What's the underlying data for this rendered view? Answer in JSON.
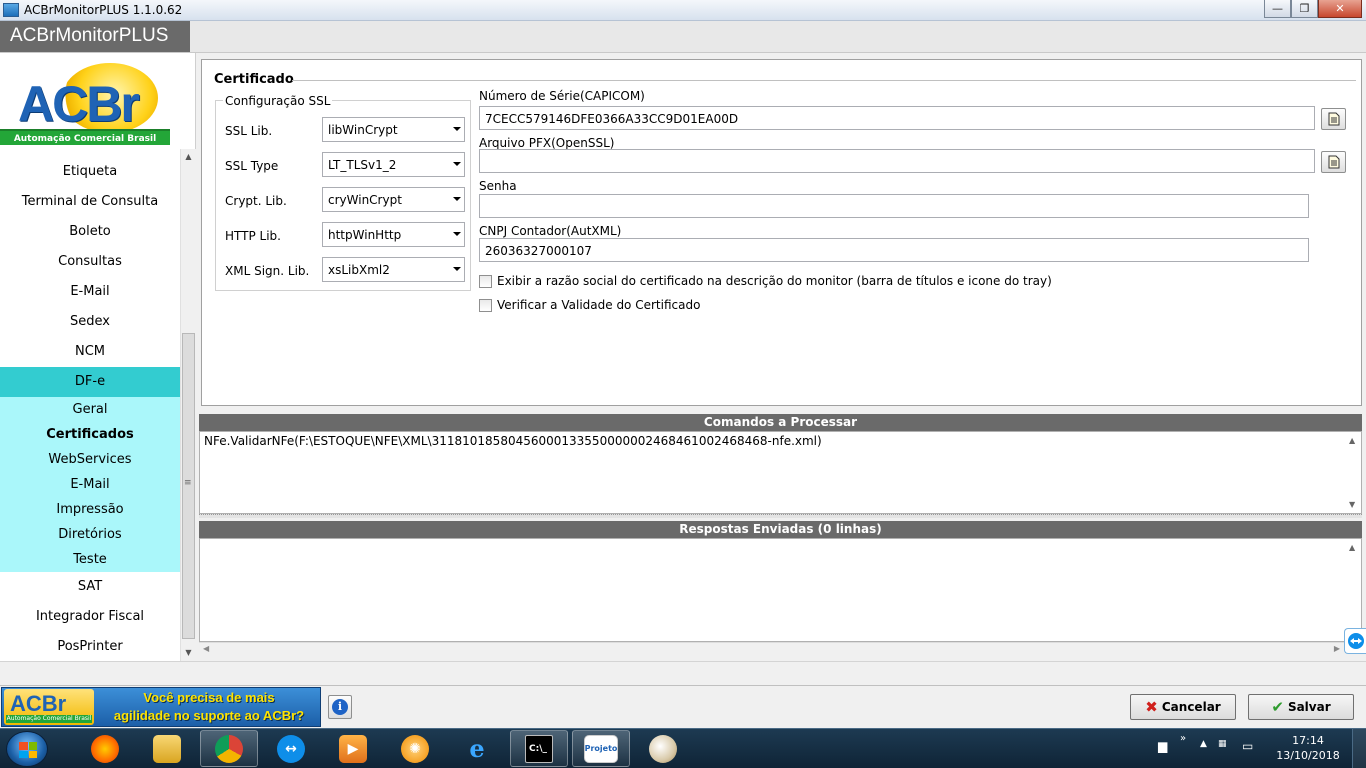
{
  "window": {
    "title": "ACBrMonitorPLUS 1.1.0.62",
    "buttons": {
      "minimize": "—",
      "maximize": "❐",
      "close": "✕"
    }
  },
  "header": {
    "app_name": "ACBrMonitorPLUS"
  },
  "logo": {
    "word_a": "AC",
    "word_b": "Br",
    "tagline": "Automação Comercial Brasil"
  },
  "sidebar": {
    "items_top": [
      "Etiqueta",
      "Terminal de Consulta",
      "Boleto",
      "Consultas",
      "E-Mail",
      "Sedex",
      "NCM"
    ],
    "active": "DF-e",
    "sub_items": [
      "Geral",
      "Certificados",
      "WebServices",
      "E-Mail",
      "Impressão",
      "Diretórios",
      "Teste"
    ],
    "current_sub": "Certificados",
    "items_bottom": [
      "SAT",
      "Integrador Fiscal",
      "PosPrinter"
    ]
  },
  "certificado": {
    "title": "Certificado",
    "ssl_group_title": "Configuração SSL",
    "ssl": [
      {
        "label": "SSL Lib.",
        "value": "libWinCrypt"
      },
      {
        "label": "SSL Type",
        "value": "LT_TLSv1_2"
      },
      {
        "label": "Crypt. Lib.",
        "value": "cryWinCrypt"
      },
      {
        "label": "HTTP Lib.",
        "value": "httpWinHttp"
      },
      {
        "label": "XML Sign. Lib.",
        "value": "xsLibXml2"
      }
    ],
    "numero_serie_label": "Número de Série(CAPICOM)",
    "numero_serie_value": "7CECC579146DFE0366A33CC9D01EA00D",
    "arquivo_pfx_label": "Arquivo PFX(OpenSSL)",
    "arquivo_pfx_value": "",
    "senha_label": "Senha",
    "senha_value": "",
    "cnpj_label": "CNPJ Contador(AutXML)",
    "cnpj_value": "26036327000107",
    "checkbox_razao": "Exibir a razão social do certificado na descrição do monitor (barra de títulos e icone do tray)",
    "checkbox_validade": "Verificar a Validade do Certificado"
  },
  "comandos": {
    "title": "Comandos a Processar",
    "lines": [
      "NFe.ValidarNFe(F:\\ESTOQUE\\NFE\\XML\\31181018580456000133550000002468461002468468-nfe.xml)"
    ]
  },
  "respostas": {
    "title": "Respostas Enviadas (0 linhas)"
  },
  "bottom": {
    "banner_line1": "Você precisa de mais",
    "banner_line2": "agilidade no suporte ao ACBr?",
    "info_label": "i",
    "cancel_label": "Cancelar",
    "save_label": "Salvar"
  },
  "taskbar": {
    "time": "17:14",
    "date": "13/10/2018",
    "apps": [
      "firefox-icon",
      "file-explorer-icon",
      "chrome-icon",
      "teamviewer-icon",
      "media-player-icon",
      "vlc-icon",
      "internet-explorer-icon",
      "cmd-icon",
      "projeto-acbr-icon",
      "paint-icon"
    ],
    "projeto_label": "Projeto"
  },
  "colors": {
    "accent": "#33ccd0",
    "subnav": "#aaf7fa",
    "section_header": "#6a6a6a"
  }
}
